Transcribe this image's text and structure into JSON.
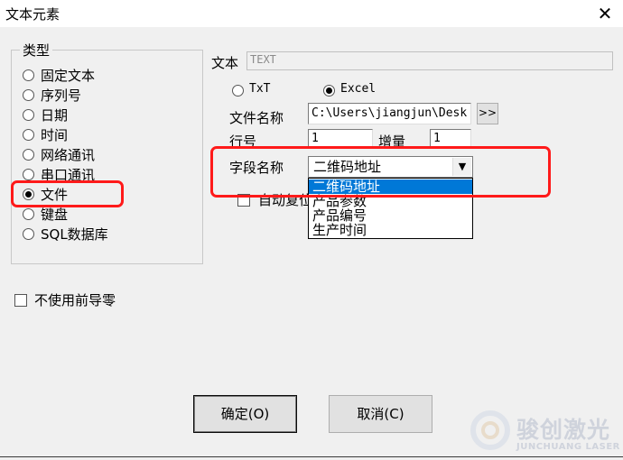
{
  "window": {
    "title": "文本元素",
    "close": "✕"
  },
  "type_group": {
    "legend": "类型",
    "options": [
      {
        "label": "固定文本",
        "selected": false
      },
      {
        "label": "序列号",
        "selected": false
      },
      {
        "label": "日期",
        "selected": false
      },
      {
        "label": "时间",
        "selected": false
      },
      {
        "label": "网络通讯",
        "selected": false
      },
      {
        "label": "串口通讯",
        "selected": false
      },
      {
        "label": "文件",
        "selected": true
      },
      {
        "label": "键盘",
        "selected": false
      },
      {
        "label": "SQL数据库",
        "selected": false
      }
    ]
  },
  "no_leading_zero": {
    "label": "不使用前导零",
    "checked": false
  },
  "text_field": {
    "label": "文本",
    "value": "TEXT"
  },
  "source": {
    "txt_label": "TxT",
    "excel_label": "Excel",
    "selected": "Excel"
  },
  "file_name": {
    "label": "文件名称",
    "value": "C:\\Users\\jiangjun\\Desk",
    "browse": ">>"
  },
  "row_number": {
    "label": "行号",
    "value": "1"
  },
  "increment": {
    "label": "增量",
    "value": "1"
  },
  "field_name": {
    "label": "字段名称",
    "value": "二维码地址",
    "options": [
      "二维码地址",
      "产品参数",
      "产品编号",
      "生产时间"
    ],
    "selected_index": 0
  },
  "auto_reset": {
    "label": "自动复位",
    "checked": false
  },
  "buttons": {
    "ok": "确定(O)",
    "cancel": "取消(C)"
  },
  "watermark": {
    "name": "骏创激光",
    "subtitle": "JUNCHUANG LASER"
  },
  "colors": {
    "highlight": "#ff1a1a",
    "selection": "#0078d7",
    "dialog_bg": "#f0f0f0"
  }
}
